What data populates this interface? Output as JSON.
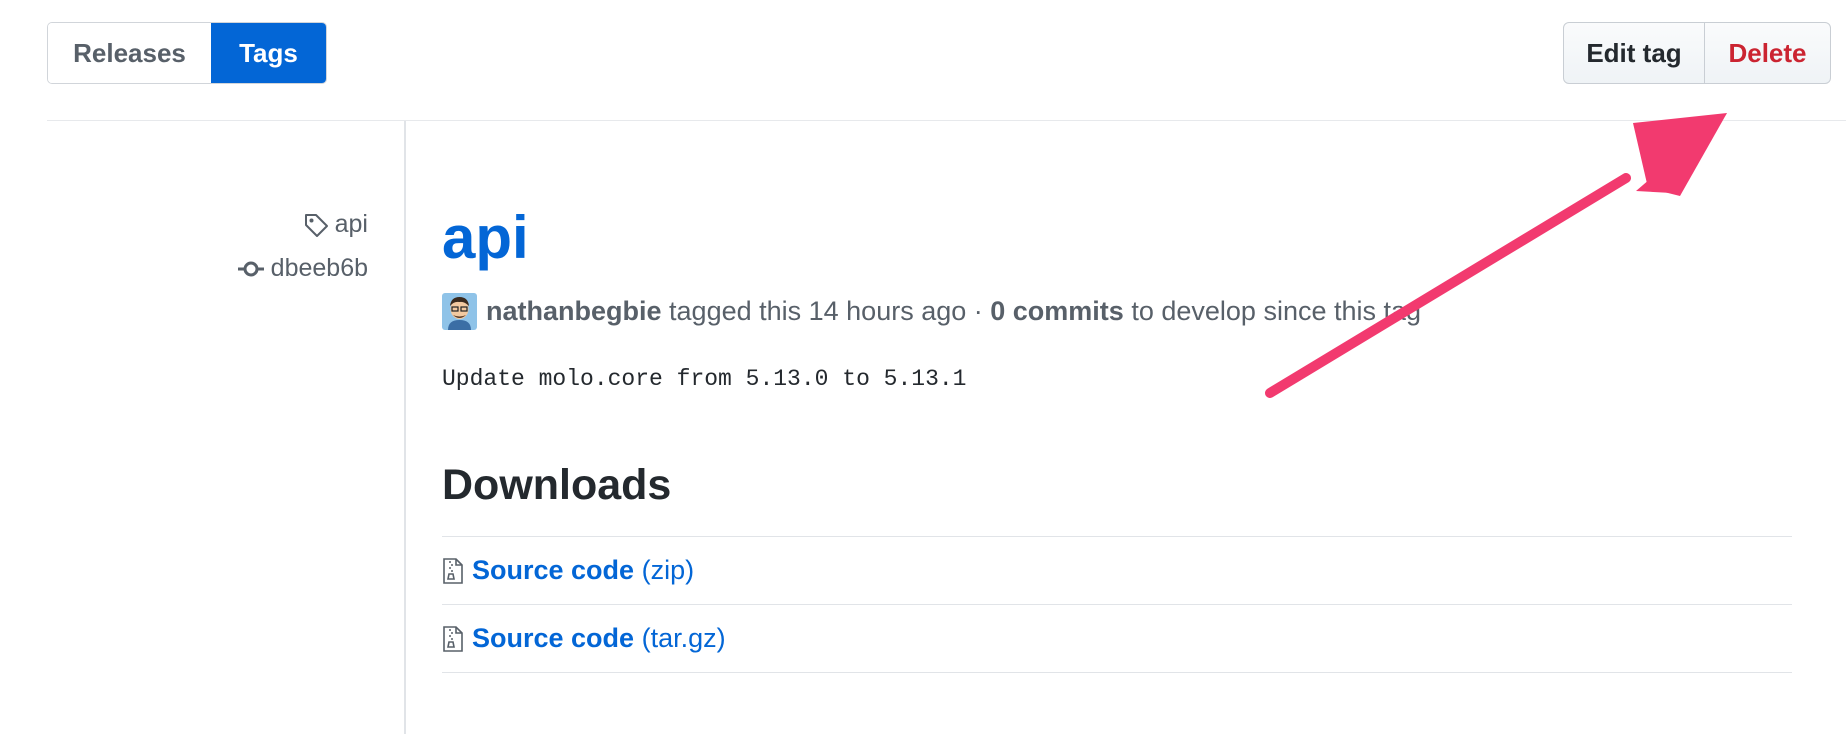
{
  "toggle": {
    "releases_label": "Releases",
    "tags_label": "Tags",
    "active": "Tags"
  },
  "actions": {
    "edit_label": "Edit tag",
    "delete_label": "Delete"
  },
  "sidebar": {
    "tag_name": "api",
    "commit_sha": "dbeeb6b"
  },
  "release": {
    "title": "api",
    "author": "nathanbegbie",
    "tagged_text": "tagged this 14 hours ago ·",
    "commits_label": "0 commits",
    "branch_text": "to develop since this tag",
    "message": "Update molo.core from 5.13.0 to 5.13.1"
  },
  "downloads": {
    "heading": "Downloads",
    "items": [
      {
        "label": "Source code",
        "type": "(zip)"
      },
      {
        "label": "Source code",
        "type": "(tar.gz)"
      }
    ]
  },
  "colors": {
    "accent": "#0366d6",
    "danger": "#cb2431",
    "annotation_arrow": "#f23a6f"
  },
  "icons": {
    "tag": "tag-icon",
    "commit": "git-commit-icon",
    "archive": "file-zip-icon"
  }
}
